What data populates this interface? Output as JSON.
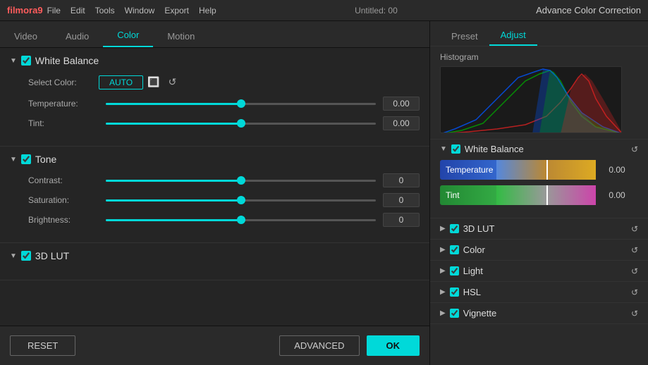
{
  "titleBar": {
    "appName": "filmora9",
    "menuItems": [
      "File",
      "Edit",
      "Tools",
      "Window",
      "Export",
      "Help"
    ],
    "title": "Untitled: 00",
    "advTitle": "Advance Color Correction"
  },
  "tabs": {
    "items": [
      "Video",
      "Audio",
      "Color",
      "Motion"
    ],
    "active": "Color"
  },
  "whiteBalance": {
    "title": "White Balance",
    "selectColorLabel": "Select Color:",
    "autoLabel": "AUTO",
    "temperatureLabel": "Temperature:",
    "temperatureValue": "0.00",
    "tintLabel": "Tint:",
    "tintValue": "0.00"
  },
  "tone": {
    "title": "Tone",
    "contrastLabel": "Contrast:",
    "contrastValue": "0",
    "saturationLabel": "Saturation:",
    "saturationValue": "0",
    "brightnessLabel": "Brightness:",
    "brightnessValue": "0"
  },
  "lut": {
    "title": "3D LUT"
  },
  "buttons": {
    "reset": "RESET",
    "advanced": "ADVANCED",
    "ok": "OK"
  },
  "rightPanel": {
    "tabs": [
      "Preset",
      "Adjust"
    ],
    "activeTab": "Adjust",
    "histogram": {
      "label": "Histogram"
    },
    "whiteBalance": {
      "title": "White Balance",
      "temperature": {
        "label": "Temperature",
        "value": "0.00"
      },
      "tint": {
        "label": "Tint",
        "value": "0.00"
      }
    },
    "items": [
      {
        "label": "3D LUT",
        "checked": true
      },
      {
        "label": "Color",
        "checked": true
      },
      {
        "label": "Light",
        "checked": true
      },
      {
        "label": "HSL",
        "checked": true
      },
      {
        "label": "Vignette",
        "checked": true
      }
    ]
  }
}
